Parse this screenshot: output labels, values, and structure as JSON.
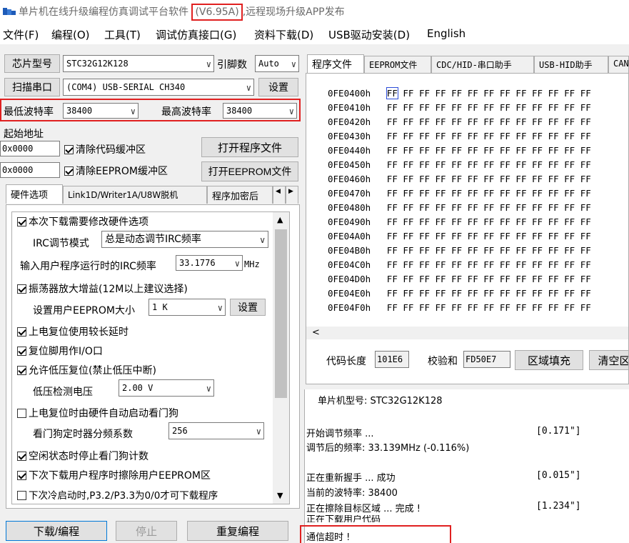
{
  "title": {
    "app": "单片机在线升级编程仿真调试平台软件",
    "version": "(V6.95A)",
    "extra": "远程现场升级APP发布"
  },
  "menu": [
    "文件(F)",
    "编程(O)",
    "工具(T)",
    "调试仿真接口(G)",
    "资料下载(D)",
    "USB驱动安装(D)",
    "English"
  ],
  "left": {
    "chip_label": "芯片型号",
    "chip_value": "STC32G12K128",
    "pins_label": "引脚数",
    "pins_value": "Auto",
    "scan_button": "扫描串口",
    "port_value": "(COM4) USB-SERIAL CH340",
    "settings_button": "设置",
    "min_baud_label": "最低波特率",
    "min_baud_value": "38400",
    "max_baud_label": "最高波特率",
    "max_baud_value": "38400",
    "start_addr_label": "起始地址",
    "addr1": "0x0000",
    "clear_code": "清除代码缓冲区",
    "open_program": "打开程序文件",
    "addr2": "0x0000",
    "clear_eeprom": "清除EEPROM缓冲区",
    "open_eeprom": "打开EEPROM文件"
  },
  "left_tabs": [
    "硬件选项",
    "Link1D/Writer1A/U8W脱机",
    "程序加密后"
  ],
  "options": {
    "opt1": "本次下载需要修改硬件选项",
    "irc_mode_label": "IRC调节模式",
    "irc_mode_value": "总是动态调节IRC频率",
    "irc_freq_label": "输入用户程序运行时的IRC频率",
    "irc_freq_value": "33.1776",
    "irc_unit": "MHz",
    "opt2": "振荡器放大增益(12M以上建议选择)",
    "eeprom_size_label": "设置用户EEPROM大小",
    "eeprom_size_value": "1   K",
    "eeprom_set_button": "设置",
    "opt3": "上电复位使用较长延时",
    "opt4": "复位脚用作I/O口",
    "opt5": "允许低压复位(禁止低压中断)",
    "lv_label": "低压检测电压",
    "lv_value": "2.00 V",
    "opt6": "上电复位时由硬件自动启动看门狗",
    "wdt_label": "看门狗定时器分频系数",
    "wdt_value": "256",
    "opt7": "空闲状态时停止看门狗计数",
    "opt8": "下次下载用户程序时擦除用户EEPROM区",
    "opt9": "下次冷启动时,P3.2/P3.3为0/0才可下载程序"
  },
  "bottom_buttons": {
    "download": "下载/编程",
    "stop": "停止",
    "repeat": "重复编程"
  },
  "right_tabs": [
    "程序文件",
    "EEPROM文件",
    "CDC/HID-串口助手",
    "USB-HID助手",
    "CAN"
  ],
  "hex_rows": [
    {
      "addr": "0FE0400h",
      "bytes": "FF FF FF FF FF FF FF FF FF FF FF FF FF"
    },
    {
      "addr": "0FE0410h",
      "bytes": "FF FF FF FF FF FF FF FF FF FF FF FF FF"
    },
    {
      "addr": "0FE0420h",
      "bytes": "FF FF FF FF FF FF FF FF FF FF FF FF FF"
    },
    {
      "addr": "0FE0430h",
      "bytes": "FF FF FF FF FF FF FF FF FF FF FF FF FF"
    },
    {
      "addr": "0FE0440h",
      "bytes": "FF FF FF FF FF FF FF FF FF FF FF FF FF"
    },
    {
      "addr": "0FE0450h",
      "bytes": "FF FF FF FF FF FF FF FF FF FF FF FF FF"
    },
    {
      "addr": "0FE0460h",
      "bytes": "FF FF FF FF FF FF FF FF FF FF FF FF FF"
    },
    {
      "addr": "0FE0470h",
      "bytes": "FF FF FF FF FF FF FF FF FF FF FF FF FF"
    },
    {
      "addr": "0FE0480h",
      "bytes": "FF FF FF FF FF FF FF FF FF FF FF FF FF"
    },
    {
      "addr": "0FE0490h",
      "bytes": "FF FF FF FF FF FF FF FF FF FF FF FF FF"
    },
    {
      "addr": "0FE04A0h",
      "bytes": "FF FF FF FF FF FF FF FF FF FF FF FF FF"
    },
    {
      "addr": "0FE04B0h",
      "bytes": "FF FF FF FF FF FF FF FF FF FF FF FF FF"
    },
    {
      "addr": "0FE04C0h",
      "bytes": "FF FF FF FF FF FF FF FF FF FF FF FF FF"
    },
    {
      "addr": "0FE04D0h",
      "bytes": "FF FF FF FF FF FF FF FF FF FF FF FF FF"
    },
    {
      "addr": "0FE04E0h",
      "bytes": "FF FF FF FF FF FF FF FF FF FF FF FF FF"
    },
    {
      "addr": "0FE04F0h",
      "bytes": "FF FF FF FF FF FF FF FF FF FF FF FF FF"
    }
  ],
  "hex_footer": {
    "code_len_label": "代码长度",
    "code_len_value": "101E6",
    "checksum_label": "校验和",
    "checksum_value": "FD50E7",
    "fill_button": "区域填充",
    "clear_button": "清空区"
  },
  "log": {
    "chip": "单片机型号: STC32G12K128",
    "l1": "开始调节频率 ...",
    "t1": "[0.171\"]",
    "l2": "调节后的频率: 33.139MHz (-0.116%)",
    "l3": "正在重新握手 ... 成功",
    "t3": "[0.015\"]",
    "l4": "当前的波特率: 38400",
    "l5": "正在擦除目标区域 ... 完成 !",
    "t5": "[1.234\"]",
    "l6": "正在下载用户代码",
    "l7": "通信超时 !"
  },
  "colors": {
    "highlight": "#e02020",
    "selection": "#2b4bd8"
  }
}
